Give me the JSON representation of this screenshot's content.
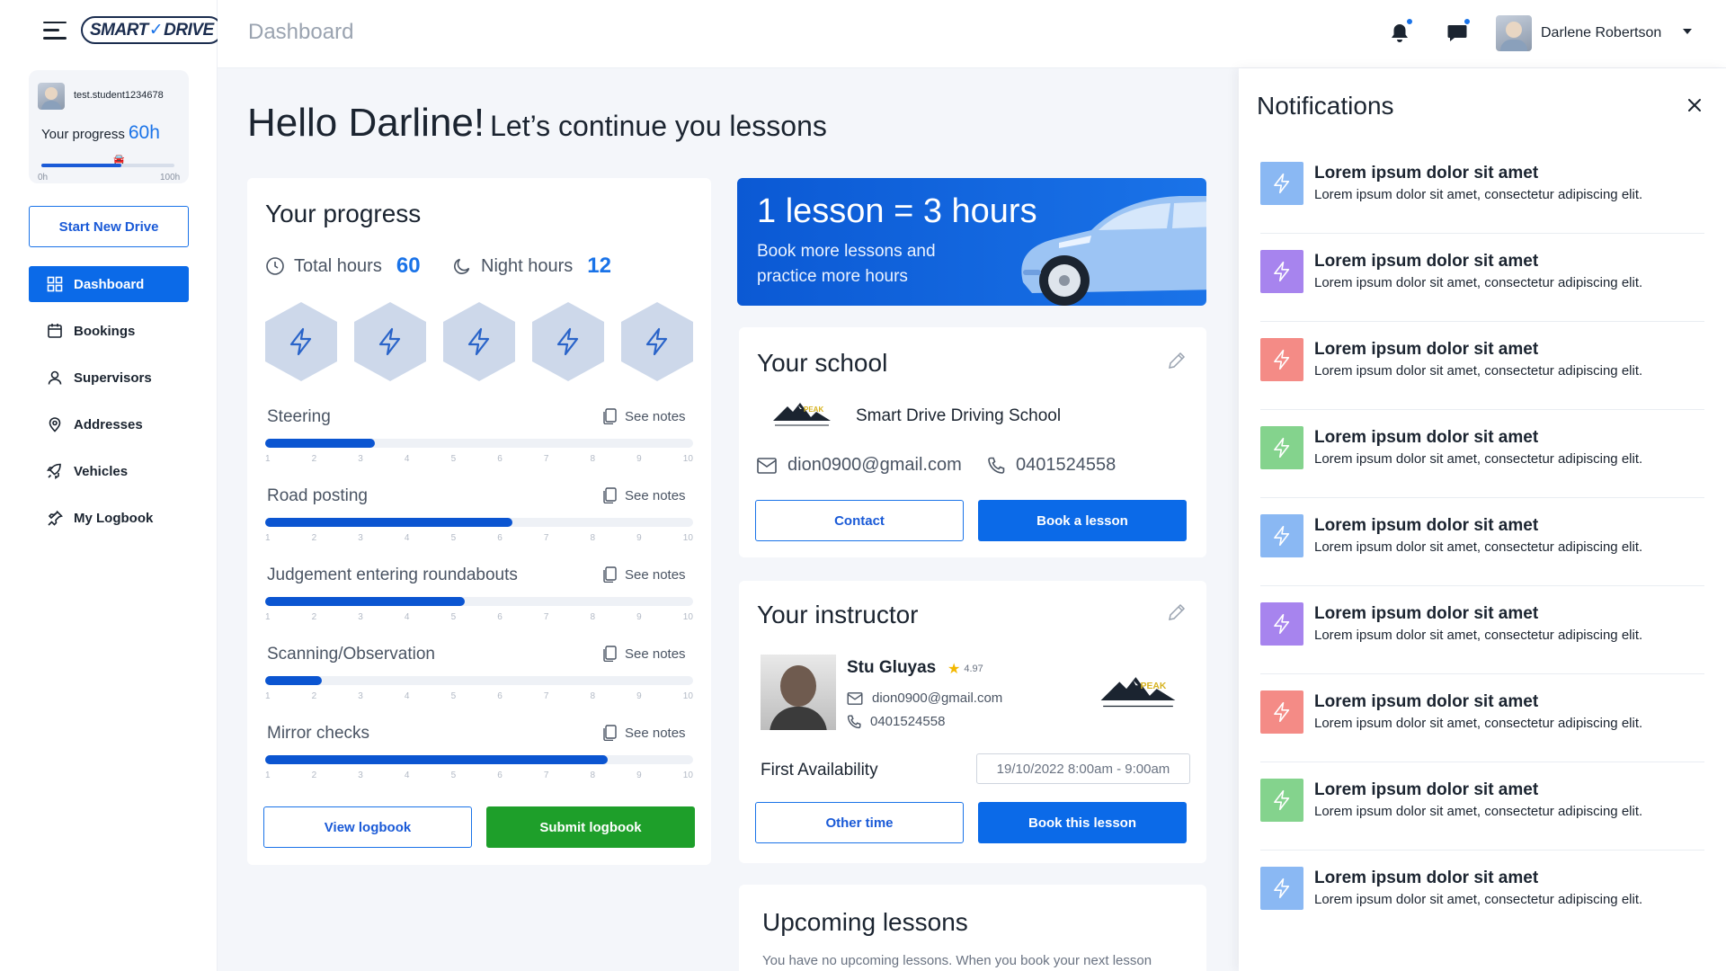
{
  "app": {
    "logo_left": "SMART",
    "logo_right": "DRIVE",
    "page_title": "Dashboard"
  },
  "sidebar": {
    "username": "test.student1234678",
    "progress_label": "Your progress",
    "progress_value": "60h",
    "progress_fraction": 0.6,
    "range_min": "0h",
    "range_max": "100h",
    "start_button": "Start New Drive",
    "items": [
      {
        "label": "Dashboard",
        "icon": "grid-icon",
        "active": true
      },
      {
        "label": "Bookings",
        "icon": "calendar-icon"
      },
      {
        "label": "Supervisors",
        "icon": "user-icon"
      },
      {
        "label": "Addresses",
        "icon": "location-pin-icon"
      },
      {
        "label": "Vehicles",
        "icon": "rocket-icon"
      },
      {
        "label": "My Logbook",
        "icon": "pin-icon"
      }
    ]
  },
  "topbar": {
    "user_name": "Darlene Robertson"
  },
  "greeting": {
    "hello": "Hello Darline!",
    "subtitle": "Let’s continue you lessons"
  },
  "progress": {
    "title": "Your progress",
    "total_label": "Total hours",
    "total_value": "60",
    "night_label": "Night hours",
    "night_value": "12",
    "see_notes": "See notes",
    "skills": [
      {
        "label": "Steering",
        "level": 3.3
      },
      {
        "label": "Road posting",
        "level": 6.2
      },
      {
        "label": "Judgement entering roundabouts",
        "level": 5.2
      },
      {
        "label": "Scanning/Observation",
        "level": 2.2
      },
      {
        "label": "Mirror checks",
        "level": 8.2
      }
    ],
    "scale": [
      "1",
      "2",
      "3",
      "4",
      "5",
      "6",
      "7",
      "8",
      "9",
      "10"
    ],
    "view_button": "View logbook",
    "submit_button": "Submit logbook"
  },
  "promo": {
    "title": "1 lesson = 3 hours",
    "subtitle": "Book more lessons and practice more hours"
  },
  "school": {
    "title": "Your school",
    "name": "Smart Drive Driving School",
    "email": "dion0900@gmail.com",
    "phone": "0401524558",
    "contact_button": "Contact",
    "book_button": "Book a lesson"
  },
  "instructor": {
    "title": "Your instructor",
    "name": "Stu Gluyas",
    "rating": "4.97",
    "email": "dion0900@gmail.com",
    "phone": "0401524558",
    "availability_label": "First Availability",
    "availability_value": "19/10/2022   8:00am - 9:00am",
    "other_button": "Other time",
    "book_button": "Book this lesson"
  },
  "upcoming": {
    "title": "Upcoming lessons",
    "text": "You have no upcoming lessons. When you book your next lesson"
  },
  "notifications": {
    "title": "Notifications",
    "items": [
      {
        "title": "Lorem ipsum dolor sit amet",
        "body": "Lorem ipsum dolor sit amet, consectetur adipiscing elit.",
        "color": "#8ab8f3"
      },
      {
        "title": "Lorem ipsum dolor sit amet",
        "body": "Lorem ipsum dolor sit amet, consectetur adipiscing elit.",
        "color": "#a784ee"
      },
      {
        "title": "Lorem ipsum dolor sit amet",
        "body": "Lorem ipsum dolor sit amet, consectetur adipiscing elit.",
        "color": "#f48b86"
      },
      {
        "title": "Lorem ipsum dolor sit amet",
        "body": "Lorem ipsum dolor sit amet, consectetur adipiscing elit.",
        "color": "#84d38d"
      },
      {
        "title": "Lorem ipsum dolor sit amet",
        "body": "Lorem ipsum dolor sit amet, consectetur adipiscing elit.",
        "color": "#8ab8f3"
      },
      {
        "title": "Lorem ipsum dolor sit amet",
        "body": "Lorem ipsum dolor sit amet, consectetur adipiscing elit.",
        "color": "#a784ee"
      },
      {
        "title": "Lorem ipsum dolor sit amet",
        "body": "Lorem ipsum dolor sit amet, consectetur adipiscing elit.",
        "color": "#f48b86"
      },
      {
        "title": "Lorem ipsum dolor sit amet",
        "body": "Lorem ipsum dolor sit amet, consectetur adipiscing elit.",
        "color": "#84d38d"
      },
      {
        "title": "Lorem ipsum dolor sit amet",
        "body": "Lorem ipsum dolor sit amet, consectetur adipiscing elit.",
        "color": "#8ab8f3"
      }
    ]
  }
}
